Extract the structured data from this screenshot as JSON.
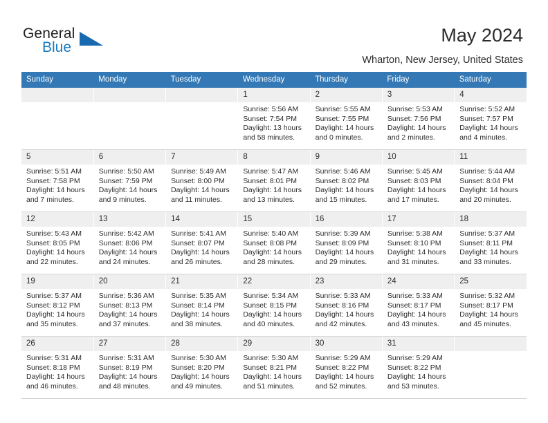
{
  "brand": {
    "name_part1": "General",
    "name_part2": "Blue",
    "accent_color": "#1769b0"
  },
  "header": {
    "title": "May 2024",
    "subtitle": "Wharton, New Jersey, United States",
    "header_bg_color": "#3479b5"
  },
  "calendar": {
    "weekday_headers": [
      "Sunday",
      "Monday",
      "Tuesday",
      "Wednesday",
      "Thursday",
      "Friday",
      "Saturday"
    ],
    "labels": {
      "sunrise_prefix": "Sunrise:",
      "sunset_prefix": "Sunset:",
      "daylight_prefix": "Daylight:"
    },
    "weeks": [
      [
        {
          "day": "",
          "empty": true
        },
        {
          "day": "",
          "empty": true
        },
        {
          "day": "",
          "empty": true
        },
        {
          "day": "1",
          "sunrise": "Sunrise: 5:56 AM",
          "sunset": "Sunset: 7:54 PM",
          "daylight_l1": "Daylight: 13 hours",
          "daylight_l2": "and 58 minutes."
        },
        {
          "day": "2",
          "sunrise": "Sunrise: 5:55 AM",
          "sunset": "Sunset: 7:55 PM",
          "daylight_l1": "Daylight: 14 hours",
          "daylight_l2": "and 0 minutes."
        },
        {
          "day": "3",
          "sunrise": "Sunrise: 5:53 AM",
          "sunset": "Sunset: 7:56 PM",
          "daylight_l1": "Daylight: 14 hours",
          "daylight_l2": "and 2 minutes."
        },
        {
          "day": "4",
          "sunrise": "Sunrise: 5:52 AM",
          "sunset": "Sunset: 7:57 PM",
          "daylight_l1": "Daylight: 14 hours",
          "daylight_l2": "and 4 minutes."
        }
      ],
      [
        {
          "day": "5",
          "sunrise": "Sunrise: 5:51 AM",
          "sunset": "Sunset: 7:58 PM",
          "daylight_l1": "Daylight: 14 hours",
          "daylight_l2": "and 7 minutes."
        },
        {
          "day": "6",
          "sunrise": "Sunrise: 5:50 AM",
          "sunset": "Sunset: 7:59 PM",
          "daylight_l1": "Daylight: 14 hours",
          "daylight_l2": "and 9 minutes."
        },
        {
          "day": "7",
          "sunrise": "Sunrise: 5:49 AM",
          "sunset": "Sunset: 8:00 PM",
          "daylight_l1": "Daylight: 14 hours",
          "daylight_l2": "and 11 minutes."
        },
        {
          "day": "8",
          "sunrise": "Sunrise: 5:47 AM",
          "sunset": "Sunset: 8:01 PM",
          "daylight_l1": "Daylight: 14 hours",
          "daylight_l2": "and 13 minutes."
        },
        {
          "day": "9",
          "sunrise": "Sunrise: 5:46 AM",
          "sunset": "Sunset: 8:02 PM",
          "daylight_l1": "Daylight: 14 hours",
          "daylight_l2": "and 15 minutes."
        },
        {
          "day": "10",
          "sunrise": "Sunrise: 5:45 AM",
          "sunset": "Sunset: 8:03 PM",
          "daylight_l1": "Daylight: 14 hours",
          "daylight_l2": "and 17 minutes."
        },
        {
          "day": "11",
          "sunrise": "Sunrise: 5:44 AM",
          "sunset": "Sunset: 8:04 PM",
          "daylight_l1": "Daylight: 14 hours",
          "daylight_l2": "and 20 minutes."
        }
      ],
      [
        {
          "day": "12",
          "sunrise": "Sunrise: 5:43 AM",
          "sunset": "Sunset: 8:05 PM",
          "daylight_l1": "Daylight: 14 hours",
          "daylight_l2": "and 22 minutes."
        },
        {
          "day": "13",
          "sunrise": "Sunrise: 5:42 AM",
          "sunset": "Sunset: 8:06 PM",
          "daylight_l1": "Daylight: 14 hours",
          "daylight_l2": "and 24 minutes."
        },
        {
          "day": "14",
          "sunrise": "Sunrise: 5:41 AM",
          "sunset": "Sunset: 8:07 PM",
          "daylight_l1": "Daylight: 14 hours",
          "daylight_l2": "and 26 minutes."
        },
        {
          "day": "15",
          "sunrise": "Sunrise: 5:40 AM",
          "sunset": "Sunset: 8:08 PM",
          "daylight_l1": "Daylight: 14 hours",
          "daylight_l2": "and 28 minutes."
        },
        {
          "day": "16",
          "sunrise": "Sunrise: 5:39 AM",
          "sunset": "Sunset: 8:09 PM",
          "daylight_l1": "Daylight: 14 hours",
          "daylight_l2": "and 29 minutes."
        },
        {
          "day": "17",
          "sunrise": "Sunrise: 5:38 AM",
          "sunset": "Sunset: 8:10 PM",
          "daylight_l1": "Daylight: 14 hours",
          "daylight_l2": "and 31 minutes."
        },
        {
          "day": "18",
          "sunrise": "Sunrise: 5:37 AM",
          "sunset": "Sunset: 8:11 PM",
          "daylight_l1": "Daylight: 14 hours",
          "daylight_l2": "and 33 minutes."
        }
      ],
      [
        {
          "day": "19",
          "sunrise": "Sunrise: 5:37 AM",
          "sunset": "Sunset: 8:12 PM",
          "daylight_l1": "Daylight: 14 hours",
          "daylight_l2": "and 35 minutes."
        },
        {
          "day": "20",
          "sunrise": "Sunrise: 5:36 AM",
          "sunset": "Sunset: 8:13 PM",
          "daylight_l1": "Daylight: 14 hours",
          "daylight_l2": "and 37 minutes."
        },
        {
          "day": "21",
          "sunrise": "Sunrise: 5:35 AM",
          "sunset": "Sunset: 8:14 PM",
          "daylight_l1": "Daylight: 14 hours",
          "daylight_l2": "and 38 minutes."
        },
        {
          "day": "22",
          "sunrise": "Sunrise: 5:34 AM",
          "sunset": "Sunset: 8:15 PM",
          "daylight_l1": "Daylight: 14 hours",
          "daylight_l2": "and 40 minutes."
        },
        {
          "day": "23",
          "sunrise": "Sunrise: 5:33 AM",
          "sunset": "Sunset: 8:16 PM",
          "daylight_l1": "Daylight: 14 hours",
          "daylight_l2": "and 42 minutes."
        },
        {
          "day": "24",
          "sunrise": "Sunrise: 5:33 AM",
          "sunset": "Sunset: 8:17 PM",
          "daylight_l1": "Daylight: 14 hours",
          "daylight_l2": "and 43 minutes."
        },
        {
          "day": "25",
          "sunrise": "Sunrise: 5:32 AM",
          "sunset": "Sunset: 8:17 PM",
          "daylight_l1": "Daylight: 14 hours",
          "daylight_l2": "and 45 minutes."
        }
      ],
      [
        {
          "day": "26",
          "sunrise": "Sunrise: 5:31 AM",
          "sunset": "Sunset: 8:18 PM",
          "daylight_l1": "Daylight: 14 hours",
          "daylight_l2": "and 46 minutes."
        },
        {
          "day": "27",
          "sunrise": "Sunrise: 5:31 AM",
          "sunset": "Sunset: 8:19 PM",
          "daylight_l1": "Daylight: 14 hours",
          "daylight_l2": "and 48 minutes."
        },
        {
          "day": "28",
          "sunrise": "Sunrise: 5:30 AM",
          "sunset": "Sunset: 8:20 PM",
          "daylight_l1": "Daylight: 14 hours",
          "daylight_l2": "and 49 minutes."
        },
        {
          "day": "29",
          "sunrise": "Sunrise: 5:30 AM",
          "sunset": "Sunset: 8:21 PM",
          "daylight_l1": "Daylight: 14 hours",
          "daylight_l2": "and 51 minutes."
        },
        {
          "day": "30",
          "sunrise": "Sunrise: 5:29 AM",
          "sunset": "Sunset: 8:22 PM",
          "daylight_l1": "Daylight: 14 hours",
          "daylight_l2": "and 52 minutes."
        },
        {
          "day": "31",
          "sunrise": "Sunrise: 5:29 AM",
          "sunset": "Sunset: 8:22 PM",
          "daylight_l1": "Daylight: 14 hours",
          "daylight_l2": "and 53 minutes."
        },
        {
          "day": "",
          "empty": true
        }
      ]
    ]
  }
}
